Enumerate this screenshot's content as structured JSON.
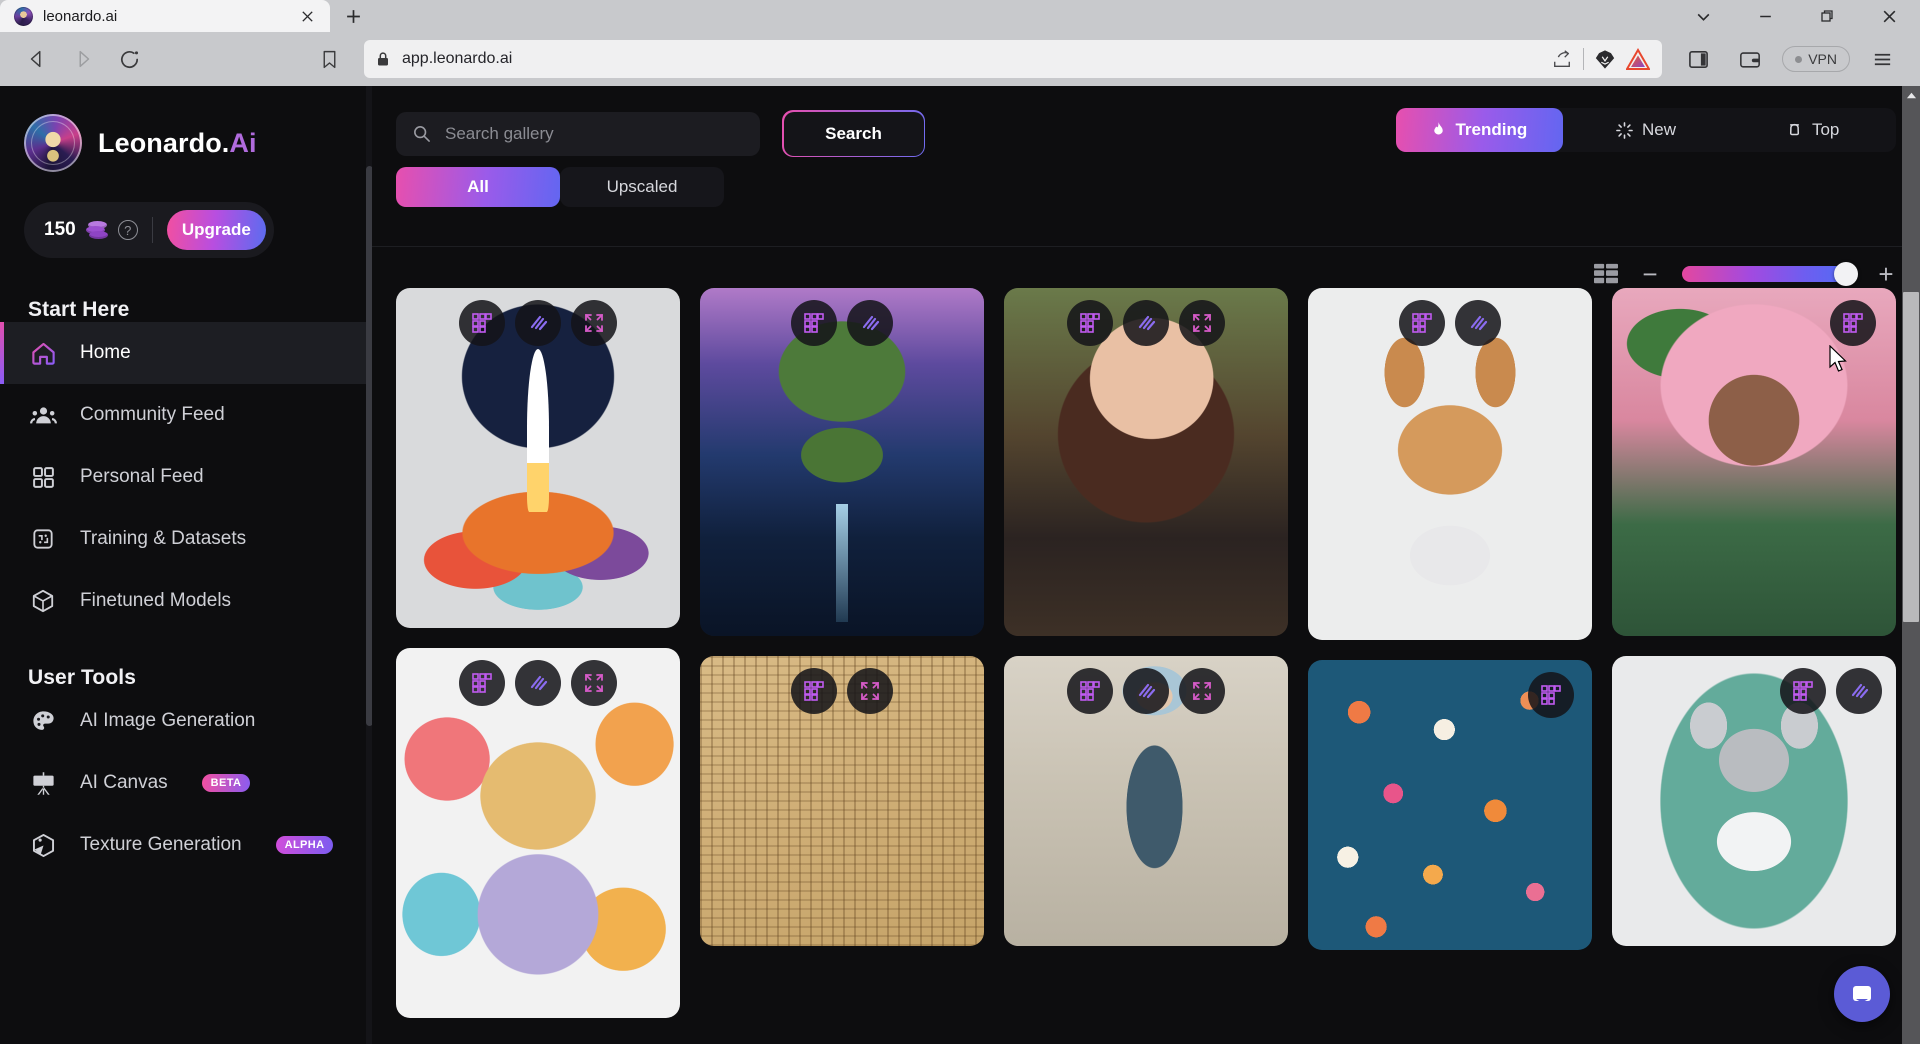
{
  "browser": {
    "tab": {
      "title": "leonardo.ai",
      "favicon_icon": "leonardo-favicon",
      "close_icon": "close-icon"
    },
    "new_tab_icon": "plus-icon",
    "window_controls": [
      {
        "name": "tab-search-button",
        "icon": "chevron-down-icon",
        "glyph": "∨"
      },
      {
        "name": "minimize-button",
        "icon": "minimize-icon",
        "glyph": "—"
      },
      {
        "name": "maximize-button",
        "icon": "restore-icon",
        "glyph": "❐"
      },
      {
        "name": "close-window-button",
        "icon": "close-icon",
        "glyph": "✕"
      }
    ],
    "nav": {
      "back_icon": "back-arrow-icon",
      "forward_icon": "forward-arrow-icon",
      "reload_icon": "reload-icon",
      "bookmark_icon": "bookmark-icon"
    },
    "url": "app.leonardo.ai",
    "url_lock_icon": "lock-icon",
    "url_actions": [
      {
        "name": "share-button",
        "icon": "share-icon"
      },
      {
        "name": "brave-shields-button",
        "icon": "brave-lion-icon"
      },
      {
        "name": "brave-rewards-button",
        "icon": "brave-triangle-icon"
      }
    ],
    "toolbar_right": [
      {
        "name": "sidebar-toggle-button",
        "icon": "sidepanel-icon"
      },
      {
        "name": "brave-wallet-button",
        "icon": "wallet-icon"
      }
    ],
    "vpn_label": "VPN",
    "menu_icon": "hamburger-menu-icon"
  },
  "sidebar": {
    "brand": {
      "name_main": "Leonardo.",
      "name_accent": "Ai",
      "logo_icon": "leonardo-logo"
    },
    "credits": {
      "amount": "150",
      "coin_icon": "credit-coins-icon",
      "help_icon": "help-circle-icon",
      "upgrade_label": "Upgrade"
    },
    "sections": [
      {
        "heading": "Start Here",
        "items": [
          {
            "label": "Home",
            "icon": "home-icon",
            "active": true
          },
          {
            "label": "Community Feed",
            "icon": "people-icon",
            "active": false
          },
          {
            "label": "Personal Feed",
            "icon": "grid-squares-icon",
            "active": false
          },
          {
            "label": "Training & Datasets",
            "icon": "dataset-chip-icon",
            "active": false
          },
          {
            "label": "Finetuned Models",
            "icon": "cube-icon",
            "active": false
          }
        ]
      },
      {
        "heading": "User Tools",
        "items": [
          {
            "label": "AI Image Generation",
            "icon": "palette-icon",
            "badge": ""
          },
          {
            "label": "AI Canvas",
            "icon": "easel-icon",
            "badge": "BETA"
          },
          {
            "label": "Texture Generation",
            "icon": "texture-cube-icon",
            "badge": "ALPHA"
          }
        ]
      }
    ]
  },
  "main": {
    "search": {
      "placeholder": "Search gallery",
      "value": "",
      "icon": "search-icon",
      "button_label": "Search"
    },
    "filters": [
      {
        "label": "All",
        "active": true
      },
      {
        "label": "Upscaled",
        "active": false
      }
    ],
    "sort_tabs": [
      {
        "label": "Trending",
        "icon": "flame-icon",
        "active": true
      },
      {
        "label": "New",
        "icon": "sparkle-icon",
        "active": false
      },
      {
        "label": "Top",
        "icon": "trophy-icon",
        "active": false
      }
    ],
    "view_controls": {
      "layout_icon": "grid-layout-icon",
      "zoom_out_label": "−",
      "zoom_in_label": "+",
      "slider_value": 100
    },
    "card_actions": {
      "upscale_icon": "upscale-grid-icon",
      "variations_icon": "variations-wand-icon",
      "fullscreen_icon": "fullscreen-expand-icon"
    },
    "gallery": {
      "columns": [
        {
          "cards": [
            {
              "name": "gallery-card-rocket-launch",
              "art": "rocket",
              "actions": [
                "upscale",
                "variations",
                "fullscreen"
              ]
            },
            {
              "name": "gallery-card-colorful-lion",
              "art": "lion",
              "actions": [
                "upscale",
                "variations",
                "fullscreen"
              ]
            }
          ]
        },
        {
          "cards": [
            {
              "name": "gallery-card-cosmic-tree",
              "art": "tree",
              "actions": [
                "upscale",
                "variations"
              ]
            },
            {
              "name": "gallery-card-hieroglyphs",
              "art": "papyrus",
              "actions": [
                "upscale",
                "fullscreen"
              ]
            }
          ]
        },
        {
          "cards": [
            {
              "name": "gallery-card-portrait-woman",
              "art": "woman",
              "actions": [
                "upscale",
                "variations",
                "fullscreen"
              ]
            },
            {
              "name": "gallery-card-blue-haired-warrior",
              "art": "warrior",
              "actions": [
                "upscale",
                "variations",
                "fullscreen"
              ]
            }
          ]
        },
        {
          "cards": [
            {
              "name": "gallery-card-chihuahua",
              "art": "dog",
              "actions": [
                "upscale",
                "variations"
              ]
            },
            {
              "name": "gallery-card-floral-pattern",
              "art": "flowers",
              "actions": [
                "upscale"
              ]
            }
          ]
        },
        {
          "cards": [
            {
              "name": "gallery-card-pink-hair-fairy",
              "art": "fairy",
              "actions": [
                "upscale"
              ]
            },
            {
              "name": "gallery-card-koala-cyclist",
              "art": "koala",
              "actions": [
                "upscale",
                "variations"
              ]
            }
          ]
        }
      ]
    },
    "chat_fab_icon": "chat-bubble-icon"
  }
}
